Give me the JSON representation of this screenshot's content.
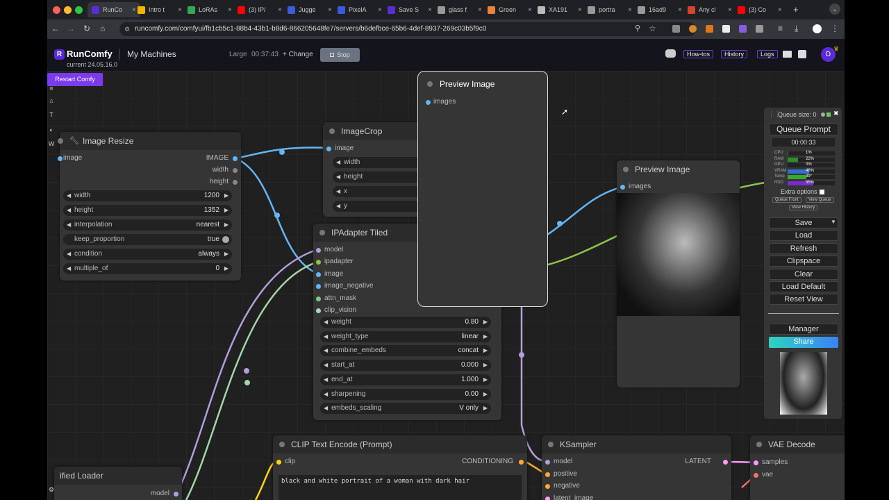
{
  "tabs": [
    {
      "label": "RunCo",
      "color": "#5a2bd8"
    },
    {
      "label": "Intro t",
      "color": "#f4b400"
    },
    {
      "label": "LoRAs",
      "color": "#34a853"
    },
    {
      "label": "(3) IP/",
      "color": "#ff0000"
    },
    {
      "label": "Jugge",
      "color": "#3b5bdb"
    },
    {
      "label": "PixelA",
      "color": "#3b5bdb"
    },
    {
      "label": "Save S",
      "color": "#5a2bd8"
    },
    {
      "label": "glass f",
      "color": "#999999"
    },
    {
      "label": "Green",
      "color": "#e8833a"
    },
    {
      "label": "XA191",
      "color": "#bbbbbb"
    },
    {
      "label": "portra",
      "color": "#999999"
    },
    {
      "label": "16ad9",
      "color": "#999999"
    },
    {
      "label": "Any cl",
      "color": "#d8432b"
    },
    {
      "label": "(3) Co",
      "color": "#ff0000"
    }
  ],
  "browser": {
    "url": "runcomfy.com/comfyui/fb1cb5c1-88b4-43b1-b8d6-866205648fe7/servers/b6defbce-65b6-4def-8937-269c03b5f9c0"
  },
  "header": {
    "brand": "RunComfy",
    "machines": "My Machines",
    "version": "current 24.05.16.0",
    "size": "Large",
    "timer": "00:37:43",
    "change": "+ Change",
    "stop": "Stop",
    "howtos": "How-tos",
    "history": "History",
    "logs": "Logs",
    "avatar": "D",
    "restart": "Restart Comfy"
  },
  "sidebar": [
    "T",
    "W"
  ],
  "nodes": {
    "image_resize": {
      "title": "Image Resize",
      "input": "image",
      "outputs": [
        "IMAGE",
        "width",
        "height"
      ],
      "widgets": [
        {
          "label": "width",
          "value": "1200"
        },
        {
          "label": "height",
          "value": "1352"
        },
        {
          "label": "interpolation",
          "value": "nearest"
        },
        {
          "label": "keep_proportion",
          "value": "true"
        },
        {
          "label": "condition",
          "value": "always"
        },
        {
          "label": "multiple_of",
          "value": "0"
        }
      ]
    },
    "image_crop": {
      "title": "ImageCrop",
      "input": "image",
      "widgets": [
        "width",
        "height",
        "x",
        "y"
      ]
    },
    "ipadapter": {
      "title": "IPAdapter Tiled",
      "inputs": [
        "model",
        "ipadapter",
        "image",
        "image_negative",
        "attn_mask",
        "clip_vision"
      ],
      "widgets": [
        {
          "label": "weight",
          "value": "0.80"
        },
        {
          "label": "weight_type",
          "value": "linear"
        },
        {
          "label": "combine_embeds",
          "value": "concat"
        },
        {
          "label": "start_at",
          "value": "0.000"
        },
        {
          "label": "end_at",
          "value": "1.000"
        },
        {
          "label": "sharpening",
          "value": "0.00"
        },
        {
          "label": "embeds_scaling",
          "value": "V only"
        }
      ]
    },
    "preview1": {
      "title": "Preview Image",
      "input": "images"
    },
    "preview2": {
      "title": "Preview Image",
      "input": "images"
    },
    "clip_text": {
      "title": "CLIP Text Encode (Prompt)",
      "input": "clip",
      "output": "CONDITIONING",
      "text": "black and white portrait of a woman with dark hair"
    },
    "ksampler": {
      "title": "KSampler",
      "inputs": [
        "model",
        "positive",
        "negative",
        "latent_image"
      ],
      "output": "LATENT"
    },
    "vae_decode": {
      "title": "VAE Decode",
      "inputs": [
        "samples",
        "vae"
      ]
    },
    "unified_loader": {
      "title": "ified Loader",
      "output": "model"
    }
  },
  "queue": {
    "size": "Queue size: 0",
    "queue_prompt": "Queue Prompt",
    "time": "00:00:33",
    "stats": [
      {
        "label": "CPU",
        "value": "1%",
        "fill": 0.01,
        "color": "#2a8f2a"
      },
      {
        "label": "RAM",
        "value": "22%",
        "fill": 0.22,
        "color": "#2a8f2a"
      },
      {
        "label": "GPU",
        "value": "0%",
        "fill": 0.0,
        "color": "#2a8f2a"
      },
      {
        "label": "VRAM",
        "value": "46%",
        "fill": 0.46,
        "color": "#2f6fd0"
      },
      {
        "label": "Temp",
        "value": "39°",
        "fill": 0.39,
        "color": "#3aa82a"
      },
      {
        "label": "HDD",
        "value": "55%",
        "fill": 0.55,
        "color": "#7a2ad0"
      }
    ],
    "extra": "Extra options",
    "queue_front": "Queue Front",
    "view_queue": "View Queue",
    "view_history": "View History",
    "buttons": [
      "Save",
      "Load",
      "Refresh",
      "Clipspace",
      "Clear",
      "Load Default",
      "Reset View"
    ],
    "manager": "Manager",
    "share": "Share"
  }
}
